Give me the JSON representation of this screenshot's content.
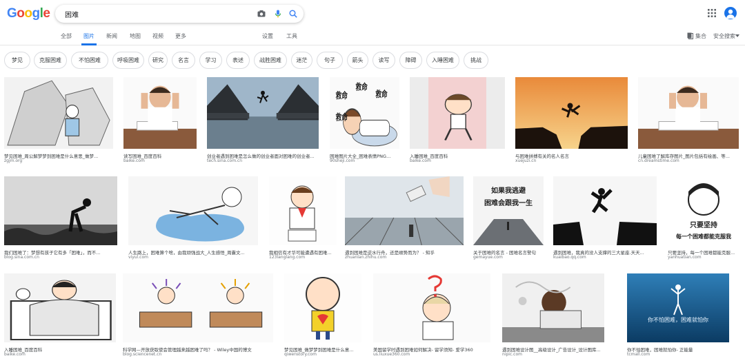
{
  "logo": {
    "text": "Google",
    "letters": [
      "G",
      "o",
      "o",
      "g",
      "l",
      "e"
    ],
    "colors": [
      "#4285F4",
      "#EA4335",
      "#FBBC05",
      "#4285F4",
      "#34A853",
      "#EA4335"
    ]
  },
  "search": {
    "query": "困难"
  },
  "tabs": {
    "all": "全部",
    "images": "图片",
    "news": "新闻",
    "maps": "地图",
    "videos": "视频",
    "more": "更多",
    "settings": "设置",
    "tools": "工具"
  },
  "header_right": {
    "collections": "集合",
    "safesearch": "安全搜索"
  },
  "chips": [
    "梦见",
    "克服困难",
    "不怕困难",
    "呼吸困难",
    "研究",
    "名言",
    "学习",
    "表述",
    "战胜困难",
    "迷茫",
    "句子",
    "箭头",
    "读写",
    "障碍",
    "入睡困难",
    "挑战"
  ],
  "results": [
    {
      "caption": "梦见困难_周公解梦梦到困难是什么意思_做梦...",
      "source": "zgjm.org"
    },
    {
      "caption": "读写困难_百度百科",
      "source": "baike.com"
    },
    {
      "caption": "创业者遇到困难是怎么做的创业者面对困难的创业者...",
      "source": "tech.sina.com.cn"
    },
    {
      "caption": "困难图片大全_困难表情PNG...",
      "source": "90sheji.com"
    },
    {
      "caption": "入睡困难_百度百科",
      "source": "baike.com"
    },
    {
      "caption": "与困难拼搏有关的名人名言",
      "source": "xuejuzi.cn"
    },
    {
      "caption": "儿童困难了解库存图片_图片包括有绘画、等...",
      "source": "cn.dreamstime.com"
    },
    {
      "caption": "我们困难了：梦想有孩子它有多「困难」，而不...",
      "source": "blog.sina.com.cn"
    },
    {
      "caption": "人生路上，困难算个啥，由我顽强战大_人生感悟_周囊文...",
      "source": "viyul.com"
    },
    {
      "caption": "我相信有才华可能遭遇有困难...",
      "source": "123langlang.com"
    },
    {
      "caption": "遇到困难是逆水行舟，还是顺势而为？ - 知乎",
      "source": "zhuanlan.zhihu.com"
    },
    {
      "caption": "关于困难的名言 - 困难名言警句",
      "source": "gemayue.com"
    },
    {
      "caption": "遇到困难，我真的没人支撑的三大星座.天天...",
      "source": "kuaibao.qq.com"
    },
    {
      "caption": "只要坚持，每一个困难都能克服...",
      "source": "yanhuatian.com"
    },
    {
      "caption": "入睡困难_百度百科",
      "source": "baike.com"
    },
    {
      "caption": "科学网—开放获取使会管理越来越困难了吗？ - Wiley中国的博文",
      "source": "blog.sciencenet.cn"
    },
    {
      "caption": "梦见困难_做梦梦到困难是什么意...",
      "source": "qiwenstory.com"
    },
    {
      "caption": "美国留学时遇到困难如何解决- 留学须知- 爱学360",
      "source": "us.liuxue360.com"
    },
    {
      "caption": "遇到困难设计图__高级设计_广告设计_设计图库...",
      "source": "nipic.com"
    },
    {
      "caption": "你不怕困难，困难就怕你- 正能量",
      "source": "tcmall.com"
    }
  ],
  "image_text": {
    "r4": [
      "救命",
      "救命",
      "救命",
      "救命"
    ],
    "r12": [
      "如果我逃避",
      "困难会跟我一生"
    ],
    "r13": [
      "Z Z"
    ],
    "r14": [
      "只要坚持",
      "每一个困难都能克服我"
    ],
    "r20": [
      "你不怕困难，困难就怕你"
    ]
  }
}
